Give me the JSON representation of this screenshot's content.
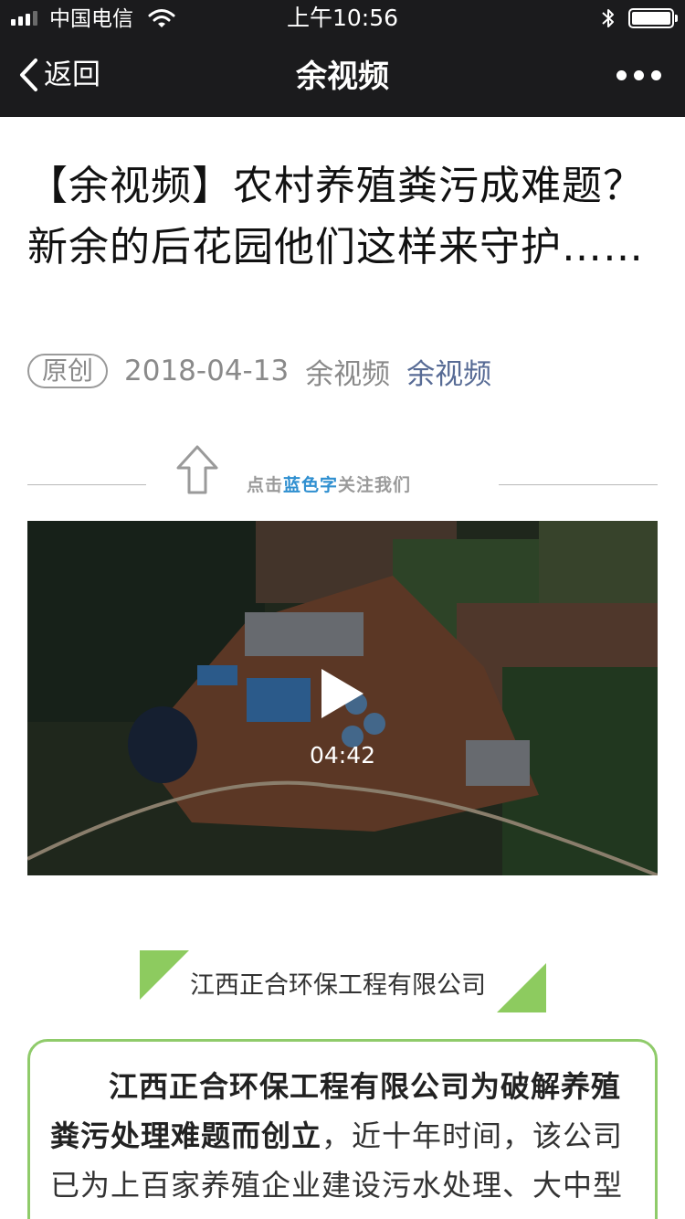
{
  "status": {
    "carrier": "中国电信",
    "time": "上午10:56"
  },
  "nav": {
    "back_label": "返回",
    "title": "余视频"
  },
  "article": {
    "title": "【余视频】农村养殖粪污成难题？新余的后花园他们这样来守护……",
    "badge": "原创",
    "date": "2018-04-13",
    "author": "余视频",
    "account": "余视频"
  },
  "follow_banner": {
    "prefix": "点击",
    "highlight": "蓝色字",
    "suffix": "关注我们"
  },
  "video": {
    "duration": "04:42"
  },
  "section": {
    "company_name": "江西正合环保工程有限公司",
    "body_bold": "江西正合环保工程有限公司为破解养殖粪污处理难题而创立",
    "body_rest": "，近十年时间，该公司已为上百家养殖企业建设污水处理、大中型沼气项目，与此同时，正合公司以"
  },
  "colors": {
    "bar_bg": "#1b1b1d",
    "link_blue": "#576b95",
    "accent_green": "#8fcb6a"
  },
  "icons": [
    "signal-icon",
    "wifi-icon",
    "bluetooth-icon",
    "battery-icon",
    "back-chevron-icon",
    "more-icon",
    "up-arrow-icon",
    "play-icon"
  ]
}
